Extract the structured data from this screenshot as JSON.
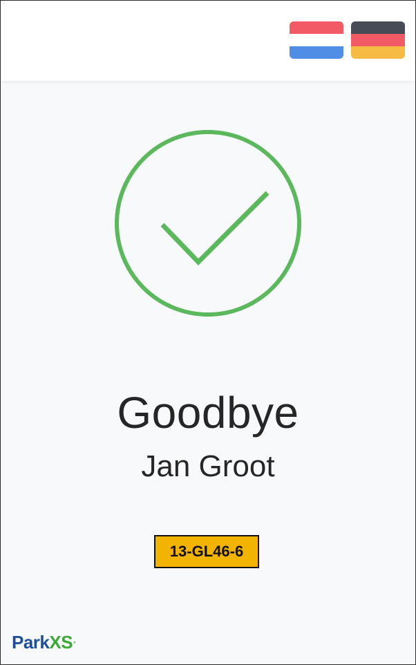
{
  "header": {
    "languages": [
      {
        "code": "nl",
        "icon": "netherlands-flag-icon",
        "colors": [
          "#f25a66",
          "#ffffff",
          "#4f8de6"
        ]
      },
      {
        "code": "de",
        "icon": "germany-flag-icon",
        "colors": [
          "#474b56",
          "#f25a66",
          "#f6bb42"
        ]
      }
    ]
  },
  "status": {
    "icon": "checkmark-circle-icon",
    "color": "#5cb85c"
  },
  "message": {
    "title": "Goodbye",
    "name": "Jan Groot"
  },
  "vehicle": {
    "plate": "13-GL46-6",
    "plate_color": "#f2b301"
  },
  "brand": {
    "logo_part1": "Park",
    "logo_part2": "XS",
    "logo_mark": "°"
  }
}
